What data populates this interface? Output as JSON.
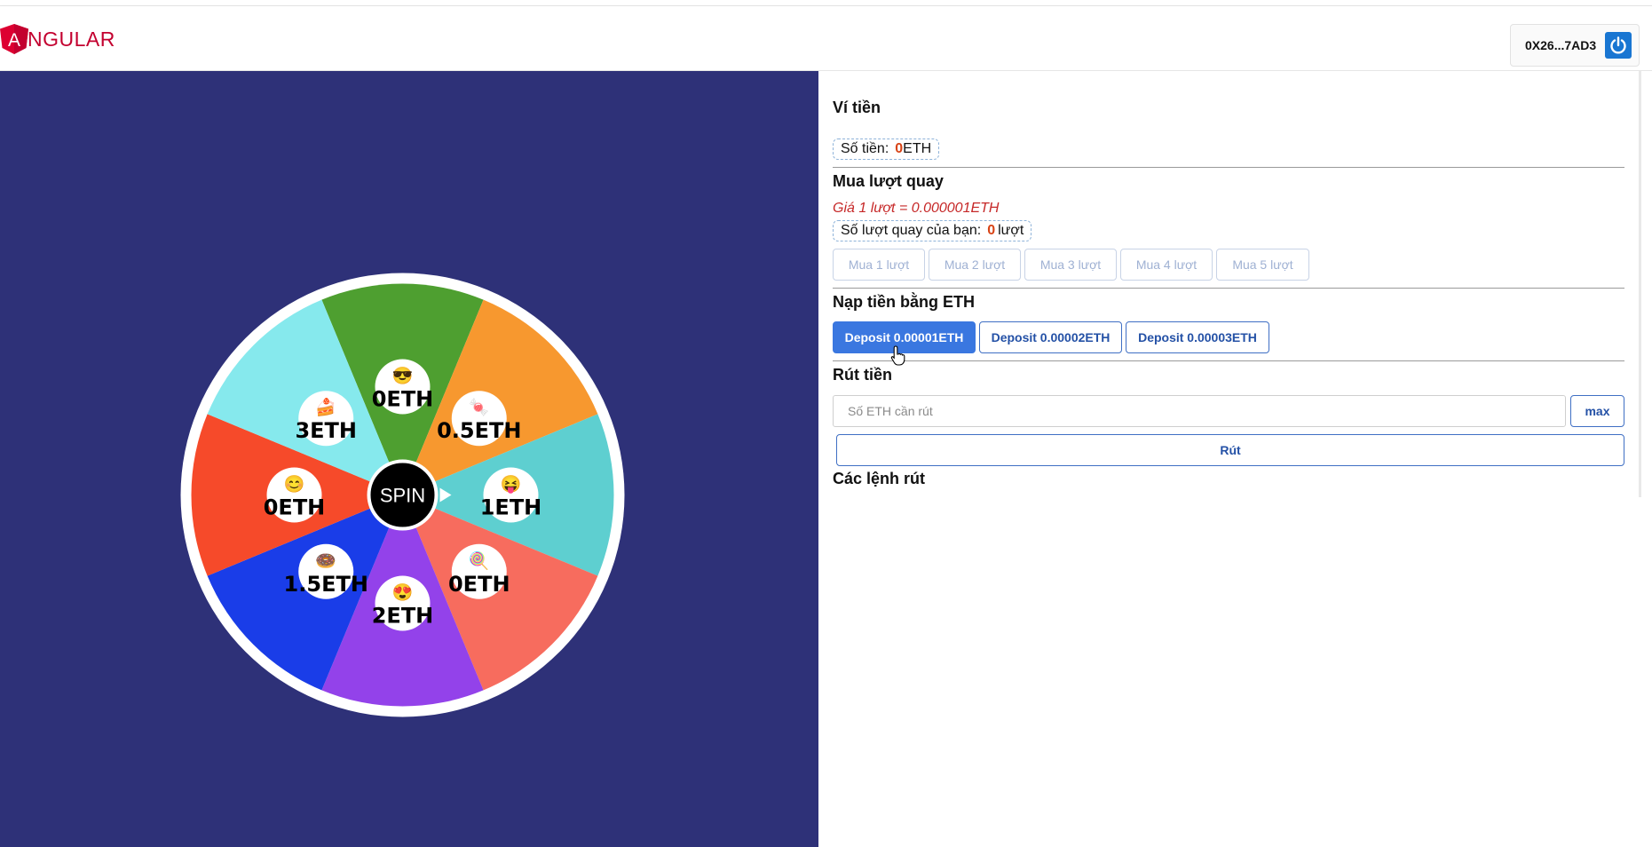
{
  "header": {
    "logo_text": "NGULAR",
    "logo_letter": "A",
    "account_address": "0X26...7AD3"
  },
  "wheel": {
    "center_label": "SPIN",
    "segments": [
      {
        "label": "0ETH",
        "emoji": "😎",
        "color": "#4e9f30"
      },
      {
        "label": "0.5ETH",
        "emoji": "🍬",
        "color": "#f7982f"
      },
      {
        "label": "1ETH",
        "emoji": "😝",
        "color": "#5ecfd0"
      },
      {
        "label": "0ETH",
        "emoji": "🍭",
        "color": "#f76c5e"
      },
      {
        "label": "2ETH",
        "emoji": "😍",
        "color": "#9342ea"
      },
      {
        "label": "1.5ETH",
        "emoji": "🍩",
        "color": "#1a3de8"
      },
      {
        "label": "0ETH",
        "emoji": "😊",
        "color": "#f64a2a"
      },
      {
        "label": "3ETH",
        "emoji": "🍰",
        "color": "#86e9ed"
      }
    ]
  },
  "wallet": {
    "title": "Ví tiền",
    "balance_label": "Số tiền:",
    "balance_value": "0",
    "balance_unit": "ETH"
  },
  "buy": {
    "title": "Mua lượt quay",
    "price_text": "Giá 1 lượt = 0.000001ETH",
    "spins_label": "Số lượt quay của bạn:",
    "spins_value": "0",
    "spins_unit": "lượt",
    "buttons": [
      "Mua 1 lượt",
      "Mua 2 lượt",
      "Mua 3 lượt",
      "Mua 4 lượt",
      "Mua 5 lượt"
    ]
  },
  "deposit": {
    "title": "Nạp tiền bằng ETH",
    "buttons": [
      "Deposit 0.00001ETH",
      "Deposit 0.00002ETH",
      "Deposit 0.00003ETH"
    ]
  },
  "withdraw": {
    "title": "Rút tiền",
    "placeholder": "Số ETH cần rút",
    "max_label": "max",
    "submit_label": "Rút"
  },
  "orders": {
    "title": "Các lệnh rút"
  }
}
